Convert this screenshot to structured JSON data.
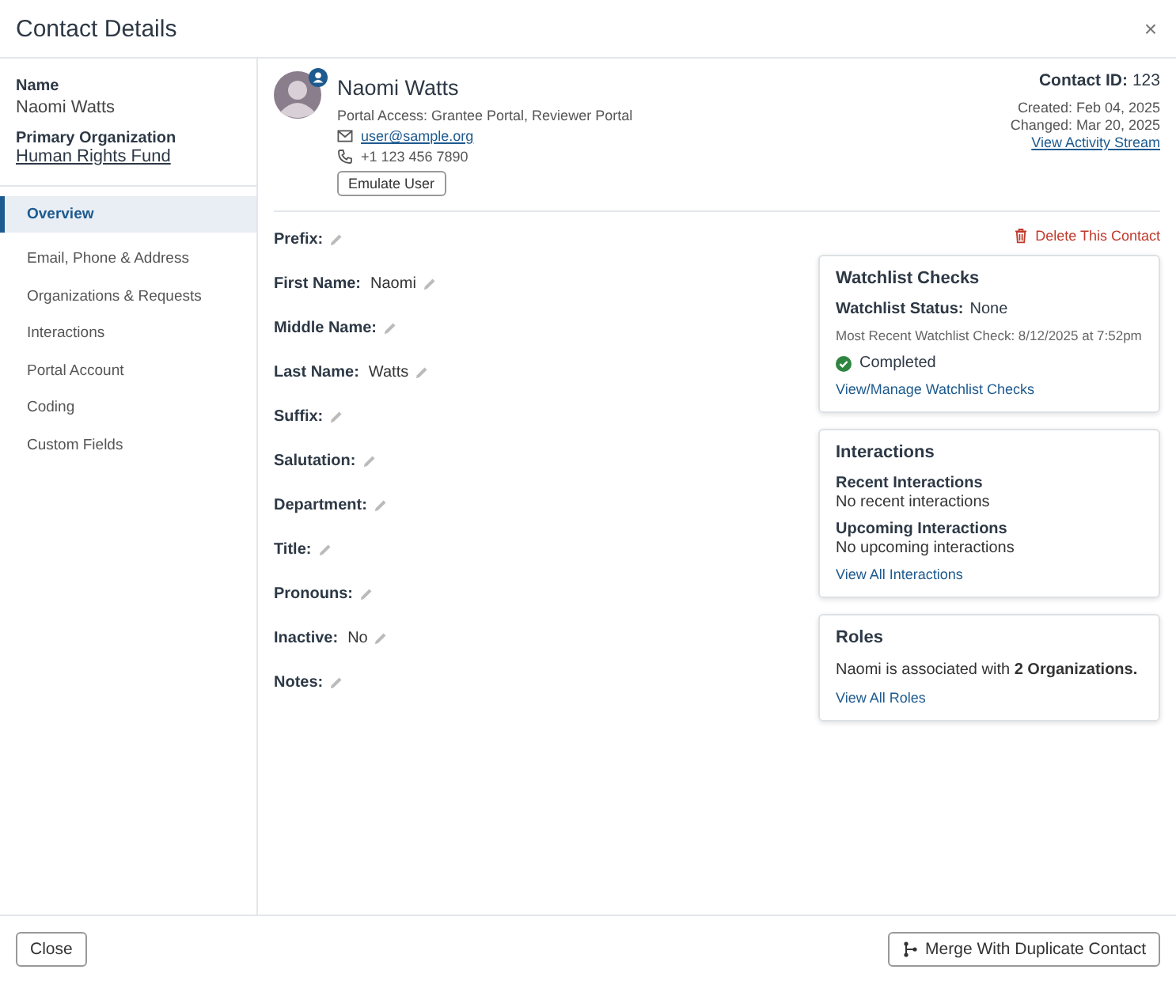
{
  "dialog": {
    "title": "Contact Details",
    "close": "×"
  },
  "summary": {
    "name_label": "Name",
    "name": "Naomi Watts",
    "org_label": "Primary Organization",
    "org": "Human Rights Fund"
  },
  "nav": [
    {
      "label": "Overview",
      "selected": true
    },
    {
      "label": "Email, Phone & Address",
      "selected": false
    },
    {
      "label": "Organizations & Requests",
      "selected": false
    },
    {
      "label": "Interactions",
      "selected": false
    },
    {
      "label": "Portal Account",
      "selected": false
    },
    {
      "label": "Coding",
      "selected": false
    },
    {
      "label": "Custom Fields",
      "selected": false
    }
  ],
  "contact": {
    "name": "Naomi Watts",
    "portal_access": "Portal Access: Grantee Portal, Reviewer Portal",
    "email": "user@sample.org",
    "phone": "+1 123 456 7890",
    "emulate_button": "Emulate User",
    "id_label": "Contact ID:",
    "id": "123",
    "created": "Created: Feb 04, 2025",
    "changed": "Changed: Mar 20, 2025",
    "activity_link": "View Activity Stream"
  },
  "delete_link": "Delete This Contact",
  "fields": [
    {
      "label": "Prefix:"
    },
    {
      "label": "First Name:",
      "value": "Naomi"
    },
    {
      "label": "Middle Name:"
    },
    {
      "label": "Last Name:",
      "value": "Watts"
    },
    {
      "label": "Suffix:"
    },
    {
      "label": "Salutation:"
    },
    {
      "label": "Department:"
    },
    {
      "label": "Title:"
    },
    {
      "label": "Pronouns:"
    },
    {
      "label": "Inactive:",
      "value": "No"
    },
    {
      "label": "Notes:"
    }
  ],
  "cards": [
    {
      "kind": "watchlist",
      "title": "Watchlist Checks",
      "status_label": "Watchlist Status:",
      "status": "None",
      "recent_check": "Most Recent Watchlist Check: 8/12/2025 at 7:52pm",
      "result": "Completed",
      "link": "View/Manage Watchlist Checks"
    },
    {
      "kind": "interactions",
      "title": "Interactions",
      "sections": [
        {
          "heading": "Recent Interactions",
          "text": "No recent interactions"
        },
        {
          "heading": "Upcoming Interactions",
          "text": "No upcoming interactions"
        }
      ],
      "link": "View All Interactions"
    },
    {
      "kind": "roles",
      "title": "Roles",
      "text": "Naomi is associated with **2 Organizations.**",
      "link": "View All Roles"
    }
  ],
  "footer": {
    "close_button": "Close",
    "merge_button": "Merge With Duplicate Contact"
  }
}
